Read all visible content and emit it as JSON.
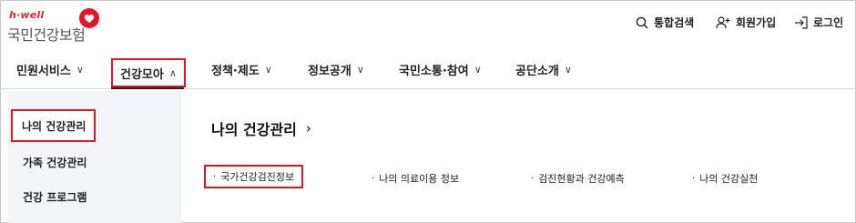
{
  "header": {
    "logo_tagline": "h·well",
    "logo_name": "국민건강보험",
    "utilities": [
      {
        "label": "통합검색",
        "icon": "search-icon"
      },
      {
        "label": "회원가입",
        "icon": "user-add-icon"
      },
      {
        "label": "로그인",
        "icon": "login-icon"
      }
    ]
  },
  "gnb": {
    "items": [
      {
        "label": "민원서비스",
        "chevron": "∨"
      },
      {
        "label": "건강모아",
        "chevron": "∧",
        "active": true
      },
      {
        "label": "정책·제도",
        "chevron": "∨"
      },
      {
        "label": "정보공개",
        "chevron": "∨"
      },
      {
        "label": "국민소통·참여",
        "chevron": "∨"
      },
      {
        "label": "공단소개",
        "chevron": "∨"
      }
    ]
  },
  "lnb": {
    "items": [
      {
        "label": "나의 건강관리",
        "active": true
      },
      {
        "label": "가족 건강관리"
      },
      {
        "label": "건강 프로그램"
      }
    ]
  },
  "main": {
    "title": "나의 건강관리",
    "title_arrow": "›",
    "links": [
      {
        "label": "국가건강검진정보",
        "highlight": true
      },
      {
        "label": "나의 의료이용 정보"
      },
      {
        "label": "검진현황과 건강예측"
      },
      {
        "label": "나의 건강실천"
      }
    ]
  },
  "colors": {
    "brand_red": "#e0162b",
    "lnb_bg": "#f3f4f7"
  }
}
